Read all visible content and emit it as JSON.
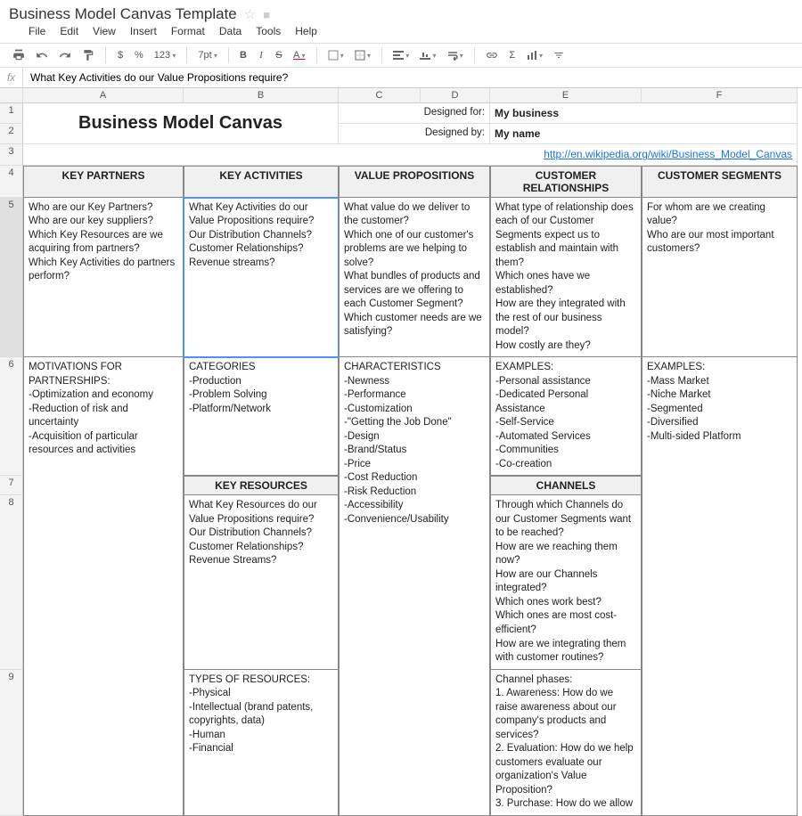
{
  "doc": {
    "title": "Business Model Canvas Template"
  },
  "menu": {
    "file": "File",
    "edit": "Edit",
    "view": "View",
    "insert": "Insert",
    "format": "Format",
    "data": "Data",
    "tools": "Tools",
    "help": "Help"
  },
  "toolbar": {
    "currency": "$",
    "percent": "%",
    "num_fmt": "123",
    "font_size": "7pt",
    "bold": "B",
    "italic": "I",
    "strike": "S",
    "text_color": "A"
  },
  "formula": {
    "value": "What Key Activities do our Value Propositions require?"
  },
  "columns": {
    "A": "A",
    "B": "B",
    "C": "C",
    "D": "D",
    "E": "E",
    "F": "F"
  },
  "rows": {
    "r1": "1",
    "r2": "2",
    "r3": "3",
    "r4": "4",
    "r5": "5",
    "r6": "6",
    "r7": "7",
    "r8": "8",
    "r9": "9"
  },
  "header": {
    "title": "Business Model Canvas",
    "designed_for_label": "Designed for:",
    "designed_for_value": "My business",
    "designed_by_label": "Designed by:",
    "designed_by_value": "My name",
    "link": "http://en.wikipedia.org/wiki/Business_Model_Canvas"
  },
  "canvas": {
    "kp": {
      "title": "KEY PARTNERS",
      "q": "Who are our Key Partners?\nWho are our key suppliers?\nWhich Key Resources are we acquiring from partners?\nWhich Key Activities do partners perform?",
      "sub": "MOTIVATIONS FOR PARTNERSHIPS:\n-Optimization and economy\n-Reduction of risk and uncertainty\n-Acquisition of particular resources and activities"
    },
    "ka": {
      "title": "KEY ACTIVITIES",
      "q": "What Key Activities do our Value Propositions require?\nOur Distribution Channels?\nCustomer Relationships?\nRevenue streams?",
      "sub": "CATEGORIES\n-Production\n-Problem Solving\n-Platform/Network"
    },
    "kr": {
      "title": "KEY RESOURCES",
      "q": "What Key Resources do our Value Propositions require?\nOur Distribution Channels?\nCustomer Relationships?\nRevenue Streams?",
      "sub": "TYPES OF RESOURCES:\n-Physical\n-Intellectual (brand patents, copyrights, data)\n-Human\n-Financial"
    },
    "vp": {
      "title": "VALUE PROPOSITIONS",
      "q": "What value do we deliver to the customer?\nWhich one of our customer's problems are we helping to solve?\nWhat bundles of products and services are we offering to each Customer Segment?\nWhich customer needs are we satisfying?",
      "sub": "CHARACTERISTICS\n-Newness\n-Performance\n-Customization\n-\"Getting the Job Done\"\n-Design\n-Brand/Status\n-Price\n-Cost Reduction\n-Risk Reduction\n-Accessibility\n-Convenience/Usability"
    },
    "cr": {
      "title": "CUSTOMER RELATIONSHIPS",
      "q": "What type of relationship does each of our Customer Segments expect us to establish and maintain with them?\nWhich ones have we established?\nHow are they integrated with the rest of our business model?\nHow costly are they?",
      "sub": "EXAMPLES:\n-Personal assistance\n-Dedicated Personal Assistance\n-Self-Service\n-Automated Services\n-Communities\n-Co-creation"
    },
    "ch": {
      "title": "CHANNELS",
      "q": "Through which Channels do our Customer Segments want to be reached?\nHow are we reaching them now?\nHow are our Channels integrated?\nWhich ones work best?\nWhich ones are most cost-efficient?\nHow are we integrating them with customer routines?",
      "sub": "Channel phases:\n1. Awareness: How do we raise awareness about our company's products and services?\n2. Evaluation: How do we help customers evaluate our organization's Value Proposition?\n3. Purchase: How do we allow"
    },
    "cs": {
      "title": "CUSTOMER SEGMENTS",
      "q": "For whom are we creating value?\nWho are our most important customers?",
      "sub": "EXAMPLES:\n-Mass Market\n-Niche Market\n-Segmented\n-Diversified\n-Multi-sided Platform"
    }
  }
}
